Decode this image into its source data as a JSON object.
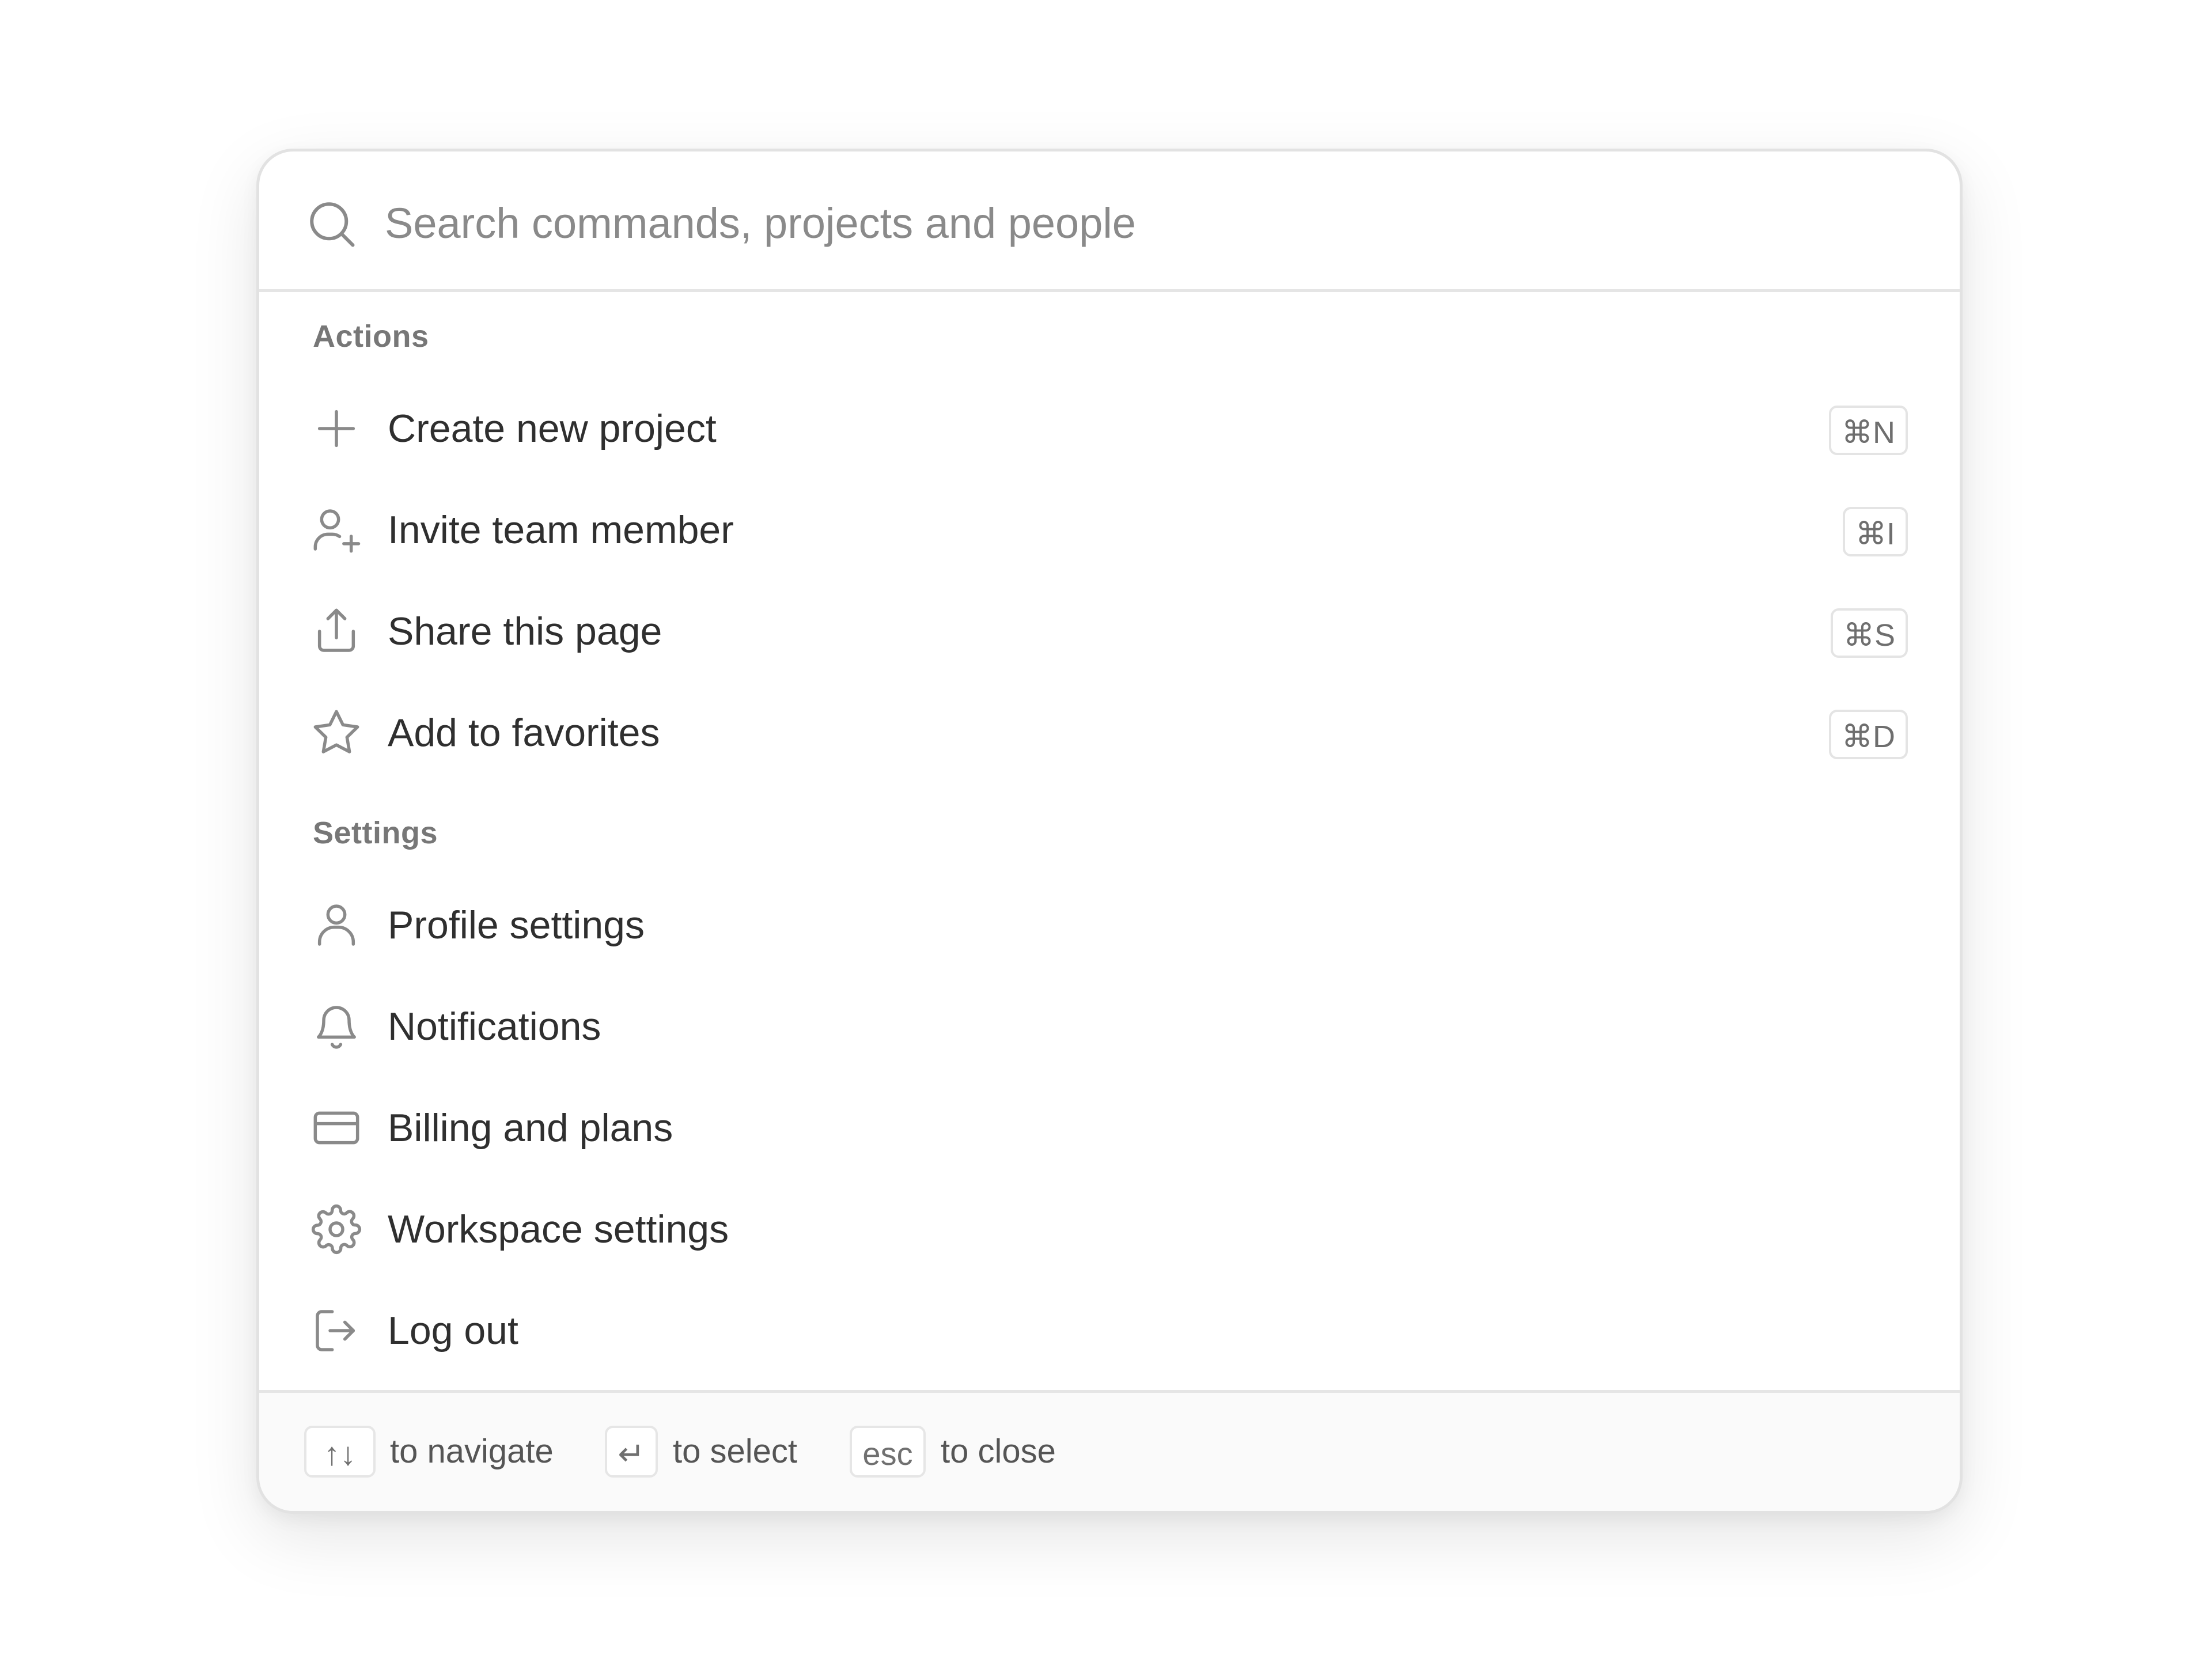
{
  "search": {
    "placeholder": "Search commands, projects and people",
    "icon": "search-icon"
  },
  "sections": {
    "actions": {
      "label": "Actions",
      "items": [
        {
          "label": "Create new project",
          "icon": "plus-icon",
          "shortcut": "⌘N"
        },
        {
          "label": "Invite team member",
          "icon": "user-plus-icon",
          "shortcut": "⌘I"
        },
        {
          "label": "Share this page",
          "icon": "share-icon",
          "shortcut": "⌘S"
        },
        {
          "label": "Add to favorites",
          "icon": "star-icon",
          "shortcut": "⌘D"
        }
      ]
    },
    "settings": {
      "label": "Settings",
      "items": [
        {
          "label": "Profile settings",
          "icon": "user-icon"
        },
        {
          "label": "Notifications",
          "icon": "bell-icon"
        },
        {
          "label": "Billing and plans",
          "icon": "credit-card-icon"
        },
        {
          "label": "Workspace settings",
          "icon": "gear-icon"
        },
        {
          "label": "Log out",
          "icon": "logout-icon"
        }
      ]
    }
  },
  "footer": {
    "navigate_key": "↑↓",
    "navigate_text": "to navigate",
    "select_key": "↵",
    "select_text": "to select",
    "close_key": "esc",
    "close_text": "to close"
  },
  "colors": {
    "text": "#2f2f2f",
    "muted": "#777777",
    "icon": "#8a8a8a",
    "border": "#e2e2e2",
    "footer_bg": "#fafafa"
  }
}
